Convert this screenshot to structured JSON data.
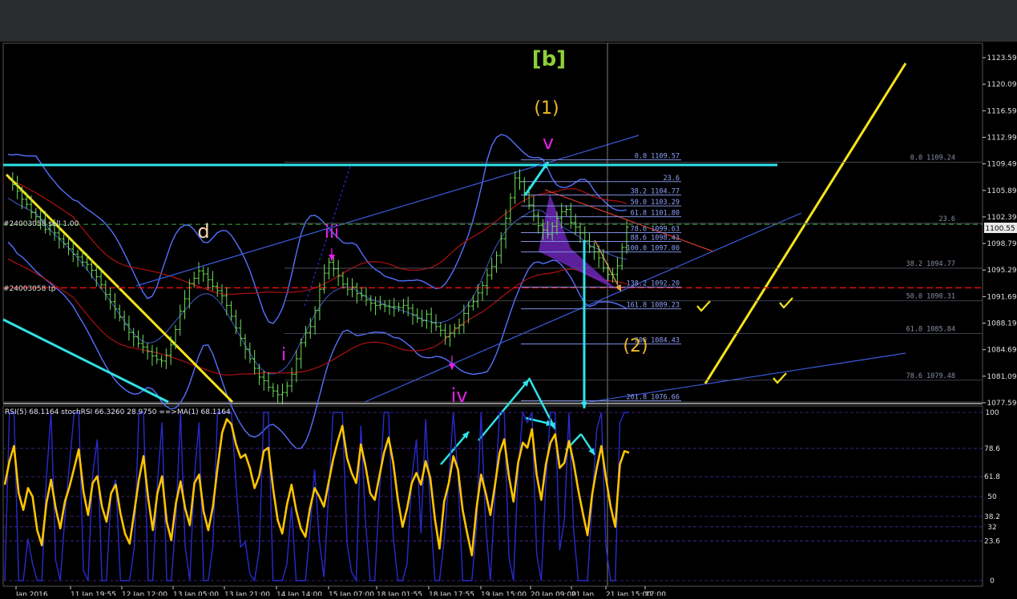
{
  "colors": {
    "background": "#000000",
    "price": "#6fe05a",
    "bollinger": "#5570ff",
    "envelope": "#b01010",
    "channel": "#3b5bdc",
    "yellow": "#f5e41a",
    "cyan": "#2fe3e8",
    "magenta": "#e81ee8",
    "fib": "#7f8fe0",
    "rsi": "#ffc400",
    "stoch": "#2a2ad0",
    "red_dash": "#e01010",
    "green_dash": "#3aa83a",
    "label_b": "#8fcf3a",
    "label_1": "#f0b828"
  },
  "wave_labels": {
    "b": "[b]",
    "one": "(1)",
    "two": "(2)",
    "d": "d",
    "v": "v",
    "iii": "iii",
    "i": "i",
    "iv": "iv"
  },
  "order_labels": {
    "sell": "#24003058 sell 1.00",
    "tp": "#24003058 tp"
  },
  "indicator_label": "RSI(5) 68.1164  stochRSI 66.3260 28.9750  ==>MA(1) 68.1164",
  "price_axis": [
    "1123.59",
    "1120.09",
    "1116.59",
    "1112.99",
    "1109.49",
    "1105.89",
    "1102.39",
    "1098.79",
    "1095.29",
    "1091.69",
    "1088.19",
    "1084.69",
    "1081.09",
    "1077.59"
  ],
  "current_price": "1100.55",
  "rsi_axis": [
    "100",
    "78.6",
    "61.8",
    "50",
    "38.2",
    "32",
    "23.6",
    "0"
  ],
  "fib_left": [
    "0.0 1109.57",
    "23.6",
    "38.2 1104.77",
    "50.0 1103.29",
    "61.8 1101.80",
    "78.6 1099.63",
    "88.6 1098.43",
    "100.0 1097.00",
    "138.2 1092.20",
    "161.8 1089.23",
    "200 1084.43",
    "261.8 1076.66"
  ],
  "fib_right": [
    "0.0 1109.24",
    "23.6",
    "38.2 1094.77",
    "50.0 1090.31",
    "61.8 1085.84",
    "78.6 1079.48"
  ],
  "time_axis": [
    "Jan 2016",
    "11 Jan 19:55",
    "12 Jan 12:00",
    "13 Jan 05:00",
    "13 Jan 21:00",
    "14 Jan 14:00",
    "15 Jan 07:00",
    "18 Jan 01:55",
    "18 Jan 17:55",
    "19 Jan 15:00",
    "20 Jan 09:00",
    "21 Jan",
    "21 Jan 15:00",
    "17:00"
  ],
  "chart_data": {
    "type": "line",
    "title": "",
    "price_range": [
      1076.5,
      1125.5
    ],
    "price_series": [
      1107,
      1106.2,
      1105.3,
      1104.2,
      1103.5,
      1102.4,
      1101.8,
      1101.4,
      1100.1,
      1100.6,
      1099.6,
      1098.8,
      1098.1,
      1097.4,
      1096.7,
      1096.3,
      1095.6,
      1095.3,
      1094.5,
      1093.6,
      1092.5,
      1091.2,
      1090.2,
      1089.2,
      1088.1,
      1087.1,
      1086.0,
      1085.4,
      1084.5,
      1084.0,
      1083.4,
      1082.8,
      1082.3,
      1082.1,
      1082.9,
      1084.3,
      1086.4,
      1088.9,
      1090.6,
      1092.7,
      1093.4,
      1094.4,
      1094.0,
      1093.2,
      1092.3,
      1091.7,
      1091.0,
      1089.7,
      1088.2,
      1086.6,
      1085.2,
      1083.7,
      1082.4,
      1081.1,
      1079.9,
      1079.4,
      1078.5,
      1078.0,
      1077.5,
      1077.8,
      1078.7,
      1080.3,
      1082.4,
      1084.6,
      1086.0,
      1086.8,
      1089.0,
      1091.9,
      1094.1,
      1095.6,
      1094.7,
      1093.7,
      1092.6,
      1091.9,
      1092.2,
      1091.3,
      1091.0,
      1090.5,
      1090.0,
      1089.7,
      1089.8,
      1089.6,
      1089.5,
      1089.5,
      1089.4,
      1089.7,
      1089.3,
      1088.4,
      1087.9,
      1087.6,
      1088.5,
      1087.3,
      1086.8,
      1086.3,
      1085.4,
      1085.9,
      1086.6,
      1087.0,
      1088.6,
      1089.6,
      1090.2,
      1091.4,
      1092.4,
      1093.8,
      1095.0,
      1096.5,
      1098.8,
      1101.6,
      1104.4,
      1107.1,
      1106.6,
      1105.1,
      1103.4,
      1102.0,
      1100.6,
      1100.0,
      1099.4,
      1100.5,
      1101.6,
      1102.5,
      1102.8,
      1101.0,
      1100.4,
      1099.6,
      1098.5,
      1097.7,
      1097.0,
      1096.2,
      1094.8,
      1093.9,
      1093.9,
      1095.1,
      1097.6,
      1100.4
    ],
    "rsi_range": [
      0,
      100
    ],
    "rsi_series": [
      57,
      71,
      80,
      52,
      42,
      55,
      50,
      30,
      21,
      46,
      60,
      43,
      31,
      47,
      56,
      67,
      78,
      53,
      39,
      58,
      62,
      44,
      35,
      52,
      57,
      40,
      28,
      22,
      41,
      60,
      74,
      49,
      30,
      52,
      62,
      35,
      24,
      46,
      59,
      43,
      33,
      58,
      63,
      41,
      30,
      44,
      67,
      88,
      96,
      93,
      81,
      73,
      75,
      67,
      55,
      62,
      77,
      79,
      55,
      36,
      28,
      45,
      57,
      42,
      31,
      26,
      43,
      55,
      50,
      44,
      58,
      72,
      83,
      92,
      73,
      64,
      58,
      81,
      68,
      52,
      48,
      62,
      76,
      85,
      70,
      48,
      32,
      43,
      58,
      64,
      57,
      71,
      61,
      37,
      19,
      47,
      58,
      74,
      66,
      42,
      28,
      15,
      43,
      63,
      52,
      39,
      57,
      76,
      84,
      62,
      47,
      70,
      82,
      79,
      90,
      63,
      48,
      69,
      82,
      87,
      67,
      70,
      83,
      70,
      54,
      40,
      27,
      51,
      67,
      80,
      61,
      44,
      32,
      69,
      77,
      76
    ],
    "stoch_rsi_series": [
      0,
      100,
      100,
      0,
      0,
      25,
      10,
      0,
      0,
      61,
      100,
      12,
      0,
      38,
      70,
      100,
      100,
      6,
      0,
      63,
      84,
      0,
      0,
      52,
      60,
      0,
      0,
      0,
      20,
      100,
      100,
      0,
      0,
      58,
      94,
      0,
      0,
      36,
      100,
      20,
      0,
      62,
      94,
      0,
      0,
      21,
      100,
      100,
      100,
      100,
      58,
      20,
      23,
      4,
      0,
      18,
      100,
      100,
      0,
      0,
      0,
      10,
      44,
      0,
      0,
      0,
      30,
      66,
      24,
      2,
      50,
      100,
      100,
      100,
      22,
      5,
      0,
      92,
      35,
      0,
      0,
      51,
      100,
      100,
      26,
      0,
      0,
      10,
      61,
      84,
      28,
      96,
      44,
      0,
      0,
      24,
      60,
      100,
      62,
      0,
      0,
      0,
      32,
      100,
      32,
      0,
      52,
      100,
      100,
      14,
      0,
      65,
      100,
      94,
      100,
      16,
      0,
      58,
      100,
      100,
      18,
      36,
      100,
      30,
      0,
      0,
      0,
      46,
      90,
      100,
      20,
      0,
      0,
      94,
      100,
      100
    ],
    "rsi_levels": [
      100,
      78.6,
      61.8,
      50,
      38.2,
      32,
      23.6,
      0
    ],
    "fib_levels_left": [
      1109.57,
      1106.6,
      1104.77,
      1103.29,
      1101.8,
      1099.63,
      1098.43,
      1097.0,
      1092.2,
      1089.23,
      1084.43,
      1076.66
    ],
    "fib_levels_right": [
      1109.24,
      1100.9,
      1094.77,
      1090.31,
      1085.84,
      1079.48
    ],
    "current_price": 1100.55,
    "tp_price": 1092.1
  }
}
